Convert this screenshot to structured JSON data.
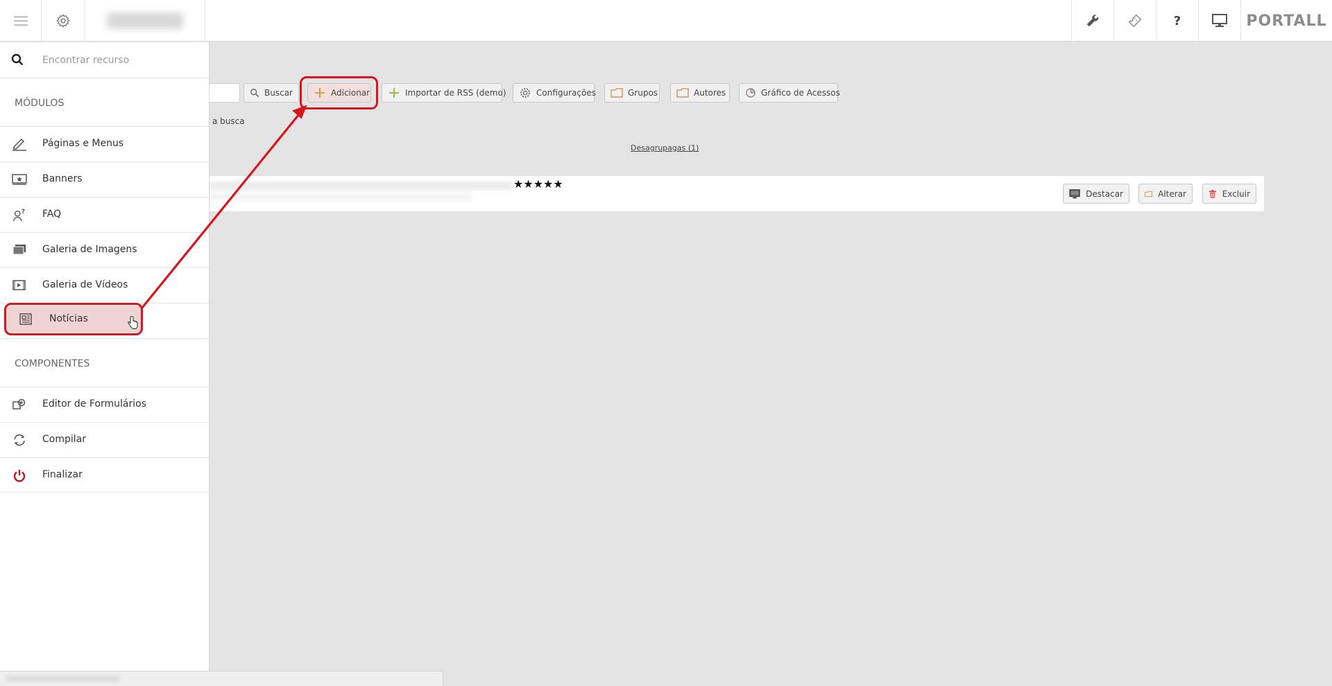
{
  "topbar": {
    "brand": "PORTALL",
    "help_label": "?",
    "icons": [
      "menu-icon",
      "gear-icon",
      "wrench-icon",
      "ticket-icon",
      "help-icon",
      "monitor-icon"
    ]
  },
  "toolbar": {
    "search_label": "Buscar",
    "add_label": "Adicionar",
    "rss_label": "Importar de RSS  (demo)",
    "config_label": "Configurações",
    "groups_label": "Grupos",
    "authors_label": "Autores",
    "chart_label": "Gráfico de Acessos"
  },
  "partial_text": "a busca",
  "ungrouped_link": "Desagrupagas (1)",
  "item": {
    "stars": "★★★★★",
    "actions": {
      "highlight_label": "Destacar",
      "edit_label": "Alterar",
      "delete_label": "Excluir"
    }
  },
  "sidebar": {
    "search_placeholder": "Encontrar recurso",
    "modules_heading": "MÓDULOS",
    "modules": [
      {
        "label": "Páginas e Menus",
        "icon": "pencil-icon"
      },
      {
        "label": "Banners",
        "icon": "banner-icon"
      },
      {
        "label": "FAQ",
        "icon": "faq-icon"
      },
      {
        "label": "Galeria de Imagens",
        "icon": "image-gallery-icon"
      },
      {
        "label": "Galeria de Vídeos",
        "icon": "video-gallery-icon"
      },
      {
        "label": "Notícias",
        "icon": "news-icon"
      }
    ],
    "components_heading": "COMPONENTES",
    "components": [
      {
        "label": "Editor de Formulários",
        "icon": "form-editor-icon"
      },
      {
        "label": "Compilar",
        "icon": "compile-icon"
      },
      {
        "label": "Finalizar",
        "icon": "power-icon"
      }
    ]
  },
  "colors": {
    "highlight": "#d8141c",
    "highlight_fill": "#f0d3d3",
    "power": "#c8131b",
    "delete": "#d33"
  }
}
